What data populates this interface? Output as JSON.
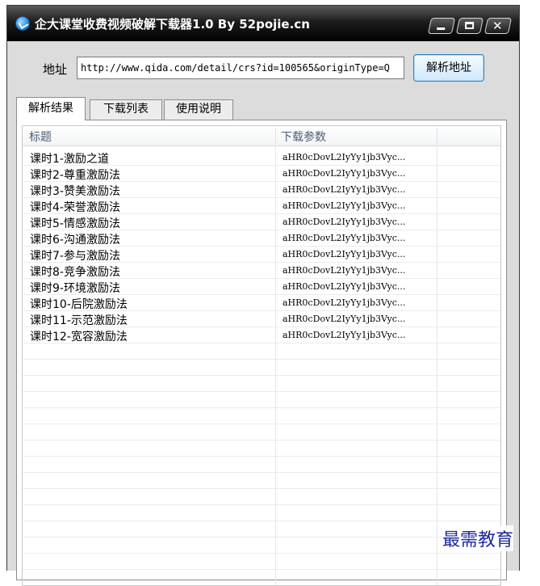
{
  "window": {
    "title": "企大课堂收费视频破解下载器1.0 By 52pojie.cn"
  },
  "address": {
    "label": "地址",
    "value": "http://www.qida.com/detail/crs?id=100565&originType=Q",
    "parse_button": "解析地址"
  },
  "tabs": [
    {
      "label": "解析结果",
      "active": true
    },
    {
      "label": "下载列表",
      "active": false
    },
    {
      "label": "使用说明",
      "active": false
    }
  ],
  "table": {
    "columns": [
      "标题",
      "下载参数"
    ],
    "rows": [
      [
        "课时1-激励之道",
        "aHR0cDovL2IyYy1jb3Vyc..."
      ],
      [
        "课时2-尊重激励法",
        "aHR0cDovL2IyYy1jb3Vyc..."
      ],
      [
        "课时3-赞美激励法",
        "aHR0cDovL2IyYy1jb3Vyc..."
      ],
      [
        "课时4-荣誉激励法",
        "aHR0cDovL2IyYy1jb3Vyc..."
      ],
      [
        "课时5-情感激励法",
        "aHR0cDovL2IyYy1jb3Vyc..."
      ],
      [
        "课时6-沟通激励法",
        "aHR0cDovL2IyYy1jb3Vyc..."
      ],
      [
        "课时7-参与激励法",
        "aHR0cDovL2IyYy1jb3Vyc..."
      ],
      [
        "课时8-竞争激励法",
        "aHR0cDovL2IyYy1jb3Vyc..."
      ],
      [
        "课时9-环境激励法",
        "aHR0cDovL2IyYy1jb3Vyc..."
      ],
      [
        "课时10-后院激励法",
        "aHR0cDovL2IyYy1jb3Vyc..."
      ],
      [
        "课时11-示范激励法",
        "aHR0cDovL2IyYy1jb3Vyc..."
      ],
      [
        "课时12-宽容激励法",
        "aHR0cDovL2IyYy1jb3Vyc..."
      ]
    ]
  },
  "watermark": "最需教育",
  "icons": {
    "app": "app-logo-icon",
    "minimize": "minimize-icon",
    "maximize": "maximize-icon",
    "close": "close-icon"
  },
  "colors": {
    "titlebar": "#1d1d1d",
    "button_border": "#3c7fb1",
    "header_text": "#4a5d78",
    "watermark": "#1f2a9e"
  }
}
